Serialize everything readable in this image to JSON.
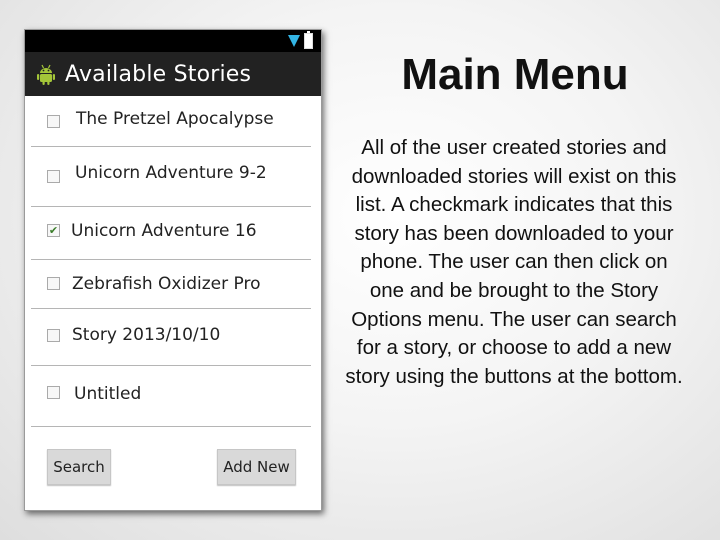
{
  "app": {
    "title": "Available Stories"
  },
  "status_icons": [
    "wifi-icon",
    "battery-icon"
  ],
  "stories": [
    {
      "label": "The Pretzel Apocalypse",
      "checked": false
    },
    {
      "label": "Unicorn Adventure 9-2",
      "checked": false
    },
    {
      "label": "Unicorn Adventure 16",
      "checked": true
    },
    {
      "label": "Zebrafish Oxidizer Pro",
      "checked": false
    },
    {
      "label": "Story 2013/10/10",
      "checked": false
    },
    {
      "label": "Untitled",
      "checked": false
    }
  ],
  "buttons": {
    "search": "Search",
    "add_new": "Add New"
  },
  "slide": {
    "title": "Main Menu",
    "body": "All of the user created stories and downloaded stories will exist on this list. A checkmark indicates that this story has been downloaded to your phone. The user can then click on one and be brought to the Story Options menu. The user can search for a story, or choose to add a new story using the buttons at the bottom."
  },
  "colors": {
    "action_bar": "#222222",
    "status_bar": "#000000",
    "wifi": "#33b5e5",
    "android_green": "#a4c639",
    "check": "#3a7d2a"
  }
}
